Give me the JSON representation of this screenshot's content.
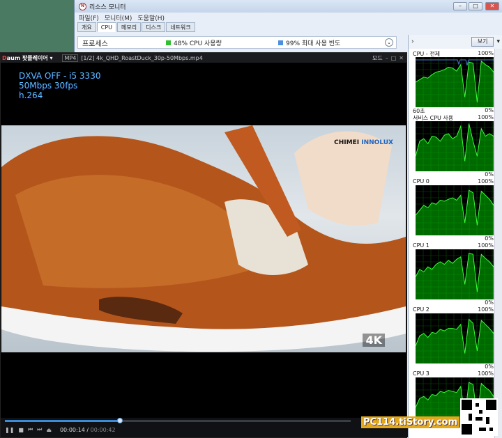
{
  "resmon": {
    "title": "리소스 모니터",
    "menu": [
      "파일(F)",
      "모니터(M)",
      "도움말(H)"
    ],
    "tabs": [
      "개요",
      "CPU",
      "메모리",
      "디스크",
      "네트워크"
    ],
    "section_title": "프로세스",
    "cpu_usage": "48% CPU 사용량",
    "max_freq": "99% 최대 사용 빈도",
    "view_button": "보기",
    "graphs": [
      {
        "label": "CPU - 전체",
        "max": "100%",
        "sub": "60초",
        "min": "0%",
        "color": "#00c000",
        "values": [
          0.5,
          0.55,
          0.6,
          0.58,
          0.65,
          0.7,
          0.72,
          0.75,
          0.8,
          0.78,
          0.72,
          0.85,
          0.2,
          0.9,
          0.88,
          0.1,
          0.92,
          0.85,
          0.8,
          0.7
        ]
      },
      {
        "label": "서비스 CPU 사용",
        "max": "100%",
        "sub": "",
        "min": "0%",
        "color": "#00c000",
        "values": [
          0.3,
          0.6,
          0.65,
          0.55,
          0.7,
          0.68,
          0.6,
          0.72,
          0.75,
          0.65,
          0.7,
          0.9,
          0.2,
          0.95,
          0.6,
          0.3,
          0.85,
          0.7,
          0.75,
          0.7
        ]
      },
      {
        "label": "CPU 0",
        "max": "100%",
        "sub": "",
        "min": "0%",
        "color": "#00c000",
        "values": [
          0.4,
          0.5,
          0.6,
          0.55,
          0.65,
          0.62,
          0.7,
          0.68,
          0.72,
          0.75,
          0.7,
          0.8,
          0.25,
          0.9,
          0.85,
          0.2,
          0.88,
          0.8,
          0.72,
          0.6
        ]
      },
      {
        "label": "CPU 1",
        "max": "100%",
        "sub": "",
        "min": "0%",
        "color": "#00c000",
        "values": [
          0.45,
          0.6,
          0.55,
          0.65,
          0.6,
          0.7,
          0.75,
          0.7,
          0.78,
          0.72,
          0.8,
          0.85,
          0.3,
          0.92,
          0.9,
          0.15,
          0.9,
          0.82,
          0.75,
          0.65
        ]
      },
      {
        "label": "CPU 2",
        "max": "100%",
        "sub": "",
        "min": "0%",
        "color": "#00c000",
        "values": [
          0.35,
          0.55,
          0.6,
          0.52,
          0.62,
          0.6,
          0.68,
          0.65,
          0.7,
          0.7,
          0.68,
          0.78,
          0.2,
          0.88,
          0.8,
          0.25,
          0.86,
          0.78,
          0.7,
          0.6
        ]
      },
      {
        "label": "CPU 3",
        "max": "100%",
        "sub": "",
        "min": "",
        "color": "#00c000",
        "values": [
          0.4,
          0.58,
          0.62,
          0.55,
          0.66,
          0.64,
          0.72,
          0.7,
          0.74,
          0.72,
          0.7,
          0.82,
          0.22,
          0.9,
          0.86,
          0.2,
          0.88,
          0.8,
          0.74,
          0.62
        ]
      }
    ]
  },
  "player": {
    "app": "팟플레이어",
    "format": "MP4",
    "file": "[1/2] 4k_QHD_RoastDuck_30p-50Mbps.mp4",
    "mode": "모드",
    "overlay": [
      "DXVA OFF - i5 3330",
      "50Mbps 30fps",
      "h.264"
    ],
    "brand_a": "CHIMEI",
    "brand_b": "INNOLUX",
    "badge": "4K",
    "time_current": "00:00:14",
    "time_total": "00:00:42",
    "progress": 0.333
  },
  "watermark": "PC114.tiStory.com"
}
